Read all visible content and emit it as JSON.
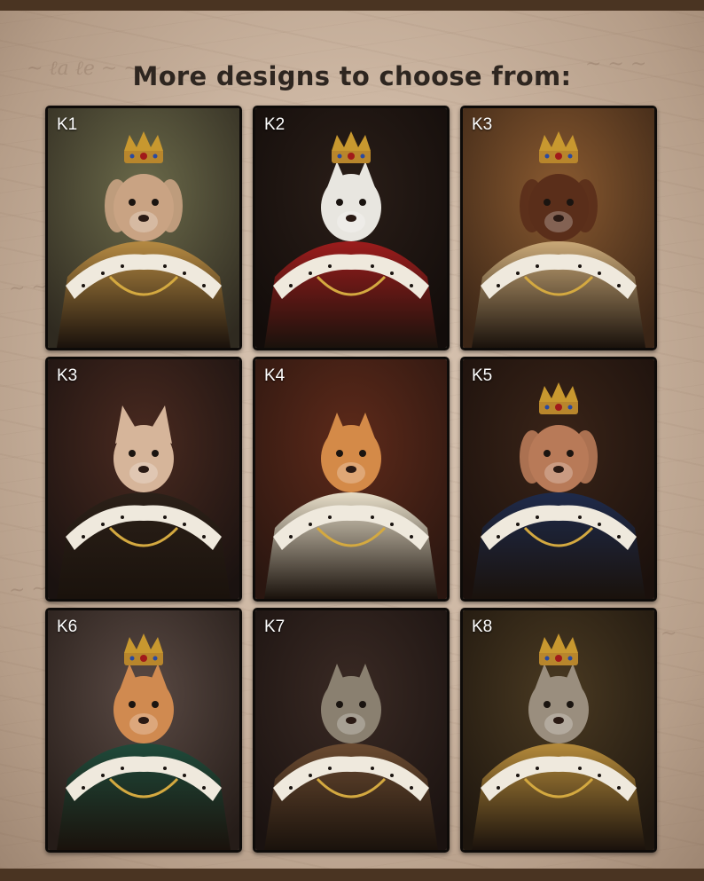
{
  "heading": "More designs to choose from:",
  "designs": [
    {
      "label": "K1",
      "animal": "bulldog",
      "crown": true,
      "bg": "#6b6a4a",
      "bg2": "#2f2a20",
      "robe": "#b58a42",
      "fur": "#c9a383"
    },
    {
      "label": "K2",
      "animal": "white-cat",
      "crown": true,
      "bg": "#2a1e18",
      "bg2": "#120c0a",
      "robe": "#9b1c1c",
      "fur": "#e8e6e0"
    },
    {
      "label": "K3",
      "animal": "dachshund",
      "crown": true,
      "bg": "#8a5a30",
      "bg2": "#3a2516",
      "robe": "#c9a877",
      "fur": "#5a2e1a"
    },
    {
      "label": "K3",
      "animal": "terrier",
      "crown": false,
      "bg": "#4a2a20",
      "bg2": "#1a1210",
      "robe": "#2b2018",
      "fur": "#d6b59a"
    },
    {
      "label": "K4",
      "animal": "ginger-cat",
      "crown": false,
      "bg": "#5e2a1a",
      "bg2": "#2a1610",
      "robe": "#e6ddc8",
      "fur": "#d48a48"
    },
    {
      "label": "K5",
      "animal": "poodle",
      "crown": true,
      "bg": "#3a2418",
      "bg2": "#1a100c",
      "robe": "#1e2a4a",
      "fur": "#b87a58"
    },
    {
      "label": "K6",
      "animal": "ginger-cat",
      "crown": true,
      "bg": "#5a4a44",
      "bg2": "#251c18",
      "robe": "#1f4a3a",
      "fur": "#d08a50"
    },
    {
      "label": "K7",
      "animal": "tabby-cat",
      "crown": false,
      "bg": "#3a2a24",
      "bg2": "#1a1210",
      "robe": "#6a4a30",
      "fur": "#8a8070"
    },
    {
      "label": "K8",
      "animal": "tabby-cat",
      "crown": true,
      "bg": "#4a3a22",
      "bg2": "#1e160e",
      "robe": "#b48a3a",
      "fur": "#9a8e7e"
    }
  ]
}
